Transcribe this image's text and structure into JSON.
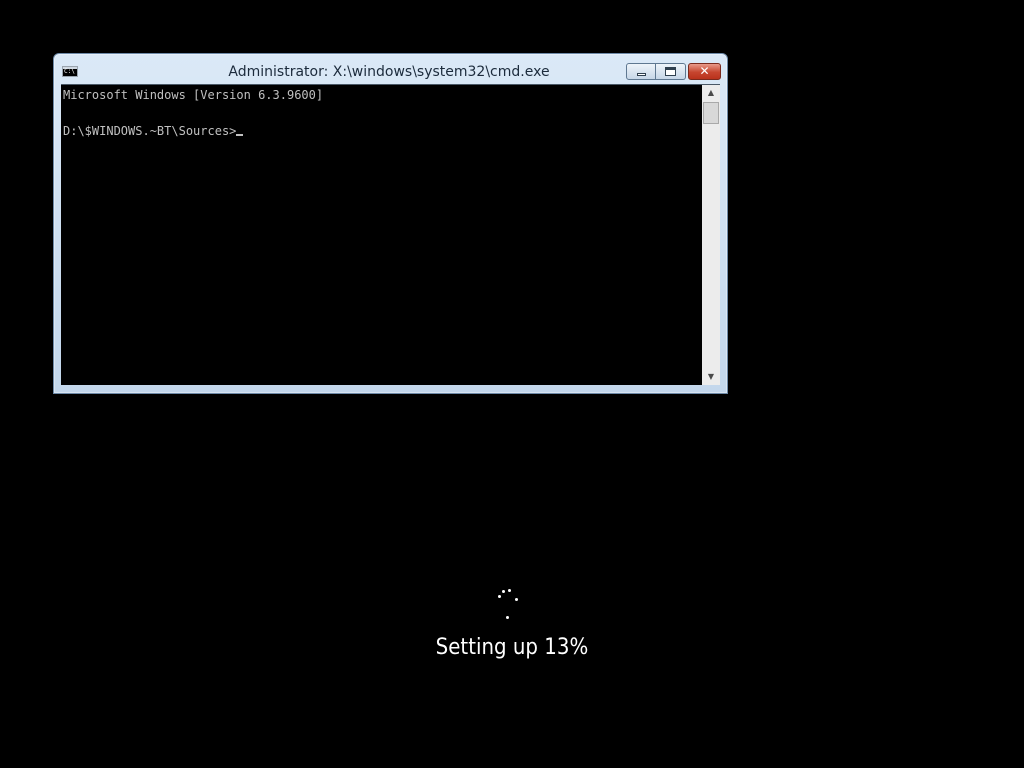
{
  "cmd_window": {
    "title": "Administrator: X:\\windows\\system32\\cmd.exe",
    "icon": "cmd-icon",
    "icon_label": "C:\\",
    "buttons": {
      "minimize": "minimize-icon",
      "maximize": "maximize-icon",
      "close": "close-icon",
      "close_glyph": "✕"
    },
    "console": {
      "lines": [
        "Microsoft Windows [Version 6.3.9600]",
        "",
        "D:\\$WINDOWS.~BT\\Sources>"
      ],
      "text_color": "#c0c0c0",
      "background": "#000000"
    },
    "scrollbar": {
      "up_arrow": "▲",
      "down_arrow": "▼"
    }
  },
  "setup": {
    "status_text": "Setting up 13%",
    "progress_percent": 13,
    "spinner": "loading-dots-icon"
  },
  "colors": {
    "desktop_background": "#000000",
    "window_frame": "#c3d7ec",
    "close_button": "#c6452f",
    "status_text": "#ffffff"
  }
}
